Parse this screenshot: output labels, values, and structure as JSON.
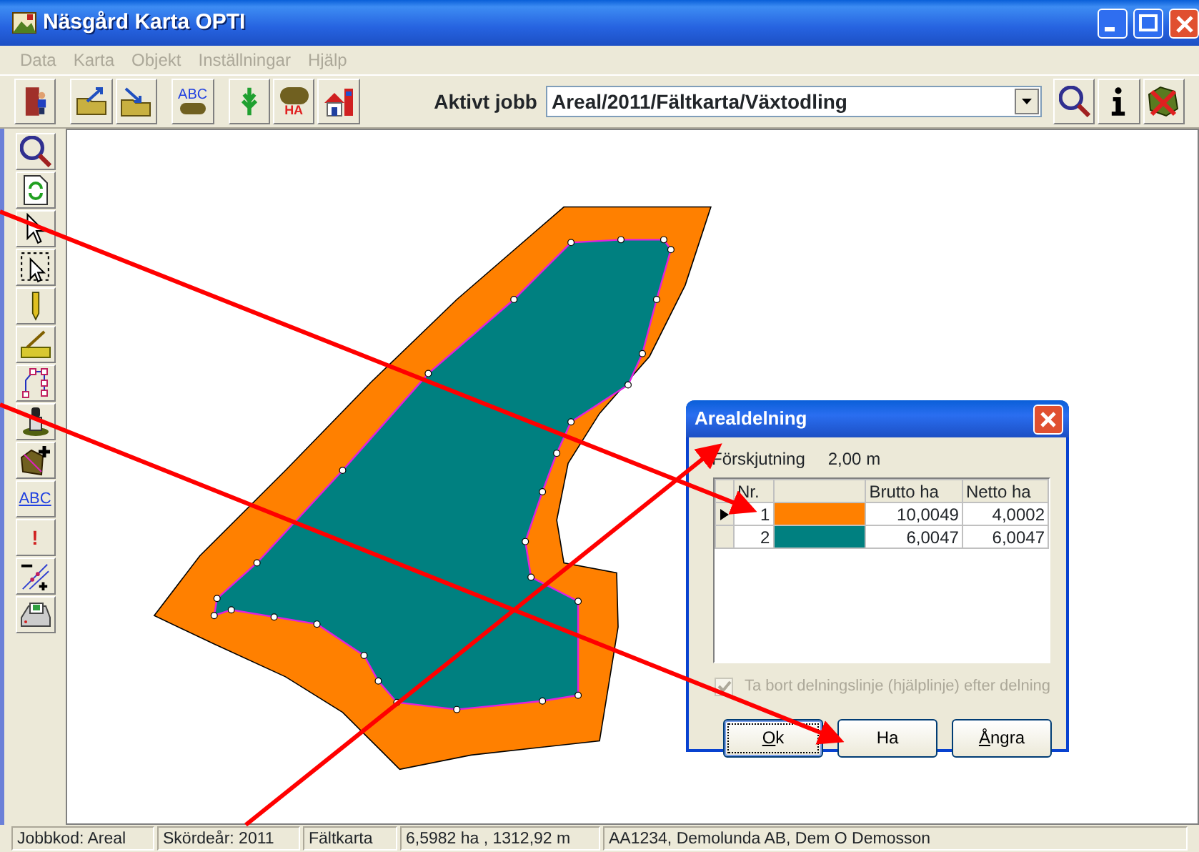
{
  "window": {
    "title": "Näsgård Karta OPTI"
  },
  "menu": [
    {
      "label": "Data",
      "disabled": true
    },
    {
      "label": "Karta",
      "disabled": true
    },
    {
      "label": "Objekt",
      "disabled": true
    },
    {
      "label": "Inställningar",
      "disabled": true
    },
    {
      "label": "Hjälp",
      "disabled": true
    }
  ],
  "toolbar": {
    "left_tools": [
      {
        "kind": "exit"
      },
      {
        "kind": "export"
      },
      {
        "kind": "import"
      },
      {
        "kind": "abc",
        "text": "ABC"
      },
      {
        "kind": "crop"
      },
      {
        "kind": "area",
        "text": "HA"
      },
      {
        "kind": "farm"
      }
    ],
    "job_label": "Aktivt jobb",
    "job_value": "Areal/2011/Fältkarta/Växtodling",
    "right_tools": [
      {
        "kind": "search"
      },
      {
        "kind": "info"
      },
      {
        "kind": "delete"
      }
    ]
  },
  "side_tools": [
    {
      "kind": "search"
    },
    {
      "kind": "refresh"
    },
    {
      "kind": "pointer"
    },
    {
      "kind": "select"
    },
    {
      "kind": "pencil"
    },
    {
      "kind": "ruler"
    },
    {
      "kind": "nodes"
    },
    {
      "kind": "stamp"
    },
    {
      "kind": "addarea"
    },
    {
      "kind": "text",
      "text": "ABC"
    },
    {
      "kind": "sign",
      "text": "!"
    },
    {
      "kind": "split"
    },
    {
      "kind": "print"
    }
  ],
  "dialog": {
    "title": "Arealdelning",
    "offset_label": "Förskjutning",
    "offset_value": "2,00 m",
    "columns": [
      {
        "label": "Nr."
      },
      {
        "kind": "color"
      },
      {
        "label": "Brutto ha"
      },
      {
        "label": "Netto ha"
      }
    ],
    "rows": [
      {
        "nr": "1",
        "color": "#ff8000",
        "brutto": "10,0049",
        "netto": "4,0002",
        "selected": true
      },
      {
        "nr": "2",
        "color": "#008080",
        "brutto": "6,0047",
        "netto": "6,0047",
        "selected": false
      }
    ],
    "checkbox": {
      "label": "Ta bort delningslinje (hjälplinje) efter delning",
      "checked": true,
      "disabled": true
    },
    "buttons": [
      {
        "label": "Ok",
        "default": true,
        "mnemonic": true
      },
      {
        "label": "Ha",
        "default": false,
        "mnemonic": false
      },
      {
        "label": "Ångra",
        "default": false,
        "mnemonic": true
      }
    ]
  },
  "status_bar": [
    "Jobbkod: Areal",
    "Skördeår: 2011",
    "Fältkarta",
    "6,5982 ha , 1312,92 m",
    "AA1234, Demolunda AB, Dem O Demosson"
  ]
}
